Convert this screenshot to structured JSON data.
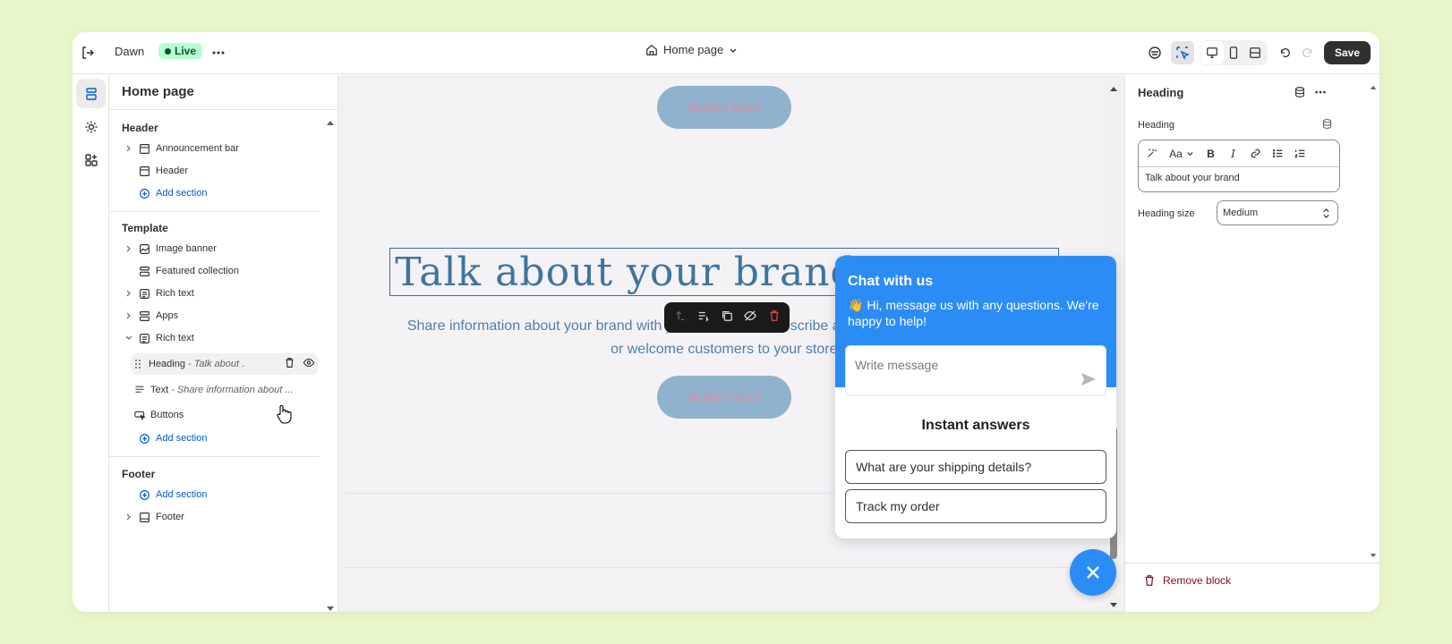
{
  "topbar": {
    "theme_name": "Dawn",
    "live_badge": "Live",
    "page_selector": "Home page",
    "save_label": "Save"
  },
  "left_panel": {
    "title": "Home page",
    "groups": {
      "header": {
        "label": "Header",
        "items": [
          "Announcement bar",
          "Header"
        ],
        "add": "Add section"
      },
      "template": {
        "label": "Template",
        "items": [
          "Image banner",
          "Featured collection",
          "Rich text",
          "Apps",
          "Rich text"
        ],
        "blocks": [
          {
            "name": "Heading",
            "detail": "- Talk about ..."
          },
          {
            "name": "Text",
            "detail": "- Share information about ..."
          },
          {
            "name": "Buttons",
            "detail": ""
          }
        ],
        "add_block": "Add section",
        "add": "Add section"
      },
      "footer": {
        "label": "Footer",
        "add": "Add section",
        "items": [
          "Footer"
        ]
      }
    }
  },
  "preview": {
    "button_label_top": "Button label",
    "heading": "Talk about your brand",
    "body_line1": "Share information about your brand with your customers. Describe a product, make announcements,",
    "body_line2": "or welcome customers to your store.",
    "button_label_bottom": "Button label"
  },
  "chat": {
    "title": "Chat with us",
    "emoji": "👋",
    "subtitle": "Hi, message us with any questions. We're happy to help!",
    "input_placeholder": "Write message",
    "instant_title": "Instant answers",
    "faqs": [
      "What are your shipping details?",
      "Track my order"
    ]
  },
  "right_panel": {
    "title": "Heading",
    "heading_label": "Heading",
    "heading_value": "Talk about your brand",
    "font_label": "Aa",
    "size_label": "Heading size",
    "size_value": "Medium",
    "remove_label": "Remove block"
  },
  "colors": {
    "accent": "#005bd3",
    "chat_blue": "#2b8cf6",
    "save_bg": "#303030",
    "danger": "#8e0b21"
  }
}
